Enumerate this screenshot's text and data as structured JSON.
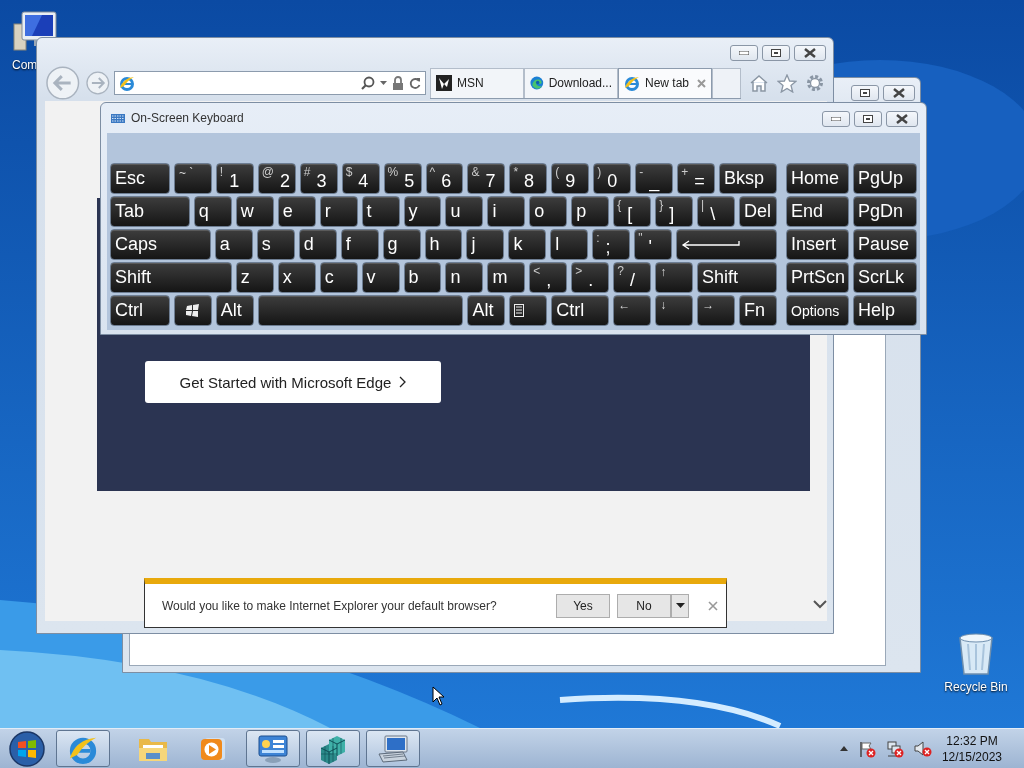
{
  "desktop_icons": [
    {
      "kind": "computer",
      "label": "Com"
    },
    {
      "kind": "recycle-bin",
      "label": "Recycle Bin"
    }
  ],
  "browser": {
    "tabs": [
      {
        "kind": "msn",
        "title": "MSN",
        "selected": false
      },
      {
        "kind": "edge",
        "title": "Download...",
        "selected": false
      },
      {
        "kind": "ie",
        "title": "New tab",
        "selected": true
      }
    ],
    "page": {
      "button": "Get Started with Microsoft Edge"
    },
    "notification": {
      "text": "Would you like to make Internet Explorer your default browser?",
      "buttons": [
        "Yes",
        "No"
      ]
    }
  },
  "keyboard": {
    "title": "On-Screen Keyboard",
    "rows": [
      {
        "keys": [
          {
            "kind": "text",
            "label": "Esc"
          },
          {
            "kind": "small",
            "label": "~ `"
          },
          {
            "kind": "dual",
            "shift": "!",
            "label": "1"
          },
          {
            "kind": "dual",
            "shift": "@",
            "label": "2"
          },
          {
            "kind": "dual",
            "shift": "#",
            "label": "3"
          },
          {
            "kind": "dual",
            "shift": "$",
            "label": "4"
          },
          {
            "kind": "dual",
            "shift": "%",
            "label": "5"
          },
          {
            "kind": "dual",
            "shift": "^",
            "label": "6"
          },
          {
            "kind": "dual",
            "shift": "&",
            "label": "7"
          },
          {
            "kind": "dual",
            "shift": "*",
            "label": "8"
          },
          {
            "kind": "dual",
            "shift": "(",
            "label": "9"
          },
          {
            "kind": "dual",
            "shift": ")",
            "label": "0"
          },
          {
            "kind": "dual",
            "shift": "-",
            "label": "_"
          },
          {
            "kind": "dual",
            "shift": "+",
            "label": "="
          },
          {
            "kind": "text",
            "label": "Bksp"
          }
        ],
        "side": [
          {
            "kind": "text",
            "label": "Home"
          },
          {
            "kind": "text",
            "label": "PgUp"
          }
        ]
      },
      {
        "keys": [
          {
            "kind": "text",
            "label": "Tab"
          },
          {
            "kind": "text",
            "label": "q"
          },
          {
            "kind": "text",
            "label": "w"
          },
          {
            "kind": "text",
            "label": "e"
          },
          {
            "kind": "text",
            "label": "r"
          },
          {
            "kind": "text",
            "label": "t"
          },
          {
            "kind": "text",
            "label": "y"
          },
          {
            "kind": "text",
            "label": "u"
          },
          {
            "kind": "text",
            "label": "i"
          },
          {
            "kind": "text",
            "label": "o"
          },
          {
            "kind": "text",
            "label": "p"
          },
          {
            "kind": "dual",
            "shift": "{",
            "label": "["
          },
          {
            "kind": "dual",
            "shift": "}",
            "label": "]"
          },
          {
            "kind": "dual",
            "shift": "|",
            "label": "\\"
          },
          {
            "kind": "text",
            "label": "Del"
          }
        ],
        "side": [
          {
            "kind": "text",
            "label": "End"
          },
          {
            "kind": "text",
            "label": "PgDn"
          }
        ]
      },
      {
        "keys": [
          {
            "kind": "text",
            "label": "Caps"
          },
          {
            "kind": "text",
            "label": "a"
          },
          {
            "kind": "text",
            "label": "s"
          },
          {
            "kind": "text",
            "label": "d"
          },
          {
            "kind": "text",
            "label": "f"
          },
          {
            "kind": "text",
            "label": "g"
          },
          {
            "kind": "text",
            "label": "h"
          },
          {
            "kind": "text",
            "label": "j"
          },
          {
            "kind": "text",
            "label": "k"
          },
          {
            "kind": "text",
            "label": "l"
          },
          {
            "kind": "dual",
            "shift": ":",
            "label": ";"
          },
          {
            "kind": "dual",
            "shift": "\"",
            "label": "'"
          },
          {
            "kind": "enter"
          }
        ],
        "side": [
          {
            "kind": "text",
            "label": "Insert"
          },
          {
            "kind": "text",
            "label": "Pause"
          }
        ]
      },
      {
        "keys": [
          {
            "kind": "text",
            "label": "Shift"
          },
          {
            "kind": "text",
            "label": "z"
          },
          {
            "kind": "text",
            "label": "x"
          },
          {
            "kind": "text",
            "label": "c"
          },
          {
            "kind": "text",
            "label": "v"
          },
          {
            "kind": "text",
            "label": "b"
          },
          {
            "kind": "text",
            "label": "n"
          },
          {
            "kind": "text",
            "label": "m"
          },
          {
            "kind": "dual",
            "shift": "<",
            "label": ","
          },
          {
            "kind": "dual",
            "shift": ">",
            "label": "."
          },
          {
            "kind": "dual",
            "shift": "?",
            "label": "/"
          },
          {
            "kind": "small",
            "label": "↑"
          },
          {
            "kind": "text",
            "label": "Shift"
          }
        ],
        "side": [
          {
            "kind": "text",
            "label": "PrtScn"
          },
          {
            "kind": "text",
            "label": "ScrLk"
          }
        ]
      },
      {
        "keys": [
          {
            "kind": "text",
            "label": "Ctrl"
          },
          {
            "kind": "windows"
          },
          {
            "kind": "text",
            "label": "Alt"
          },
          {
            "kind": "space"
          },
          {
            "kind": "text",
            "label": "Alt"
          },
          {
            "kind": "menu"
          },
          {
            "kind": "text",
            "label": "Ctrl"
          },
          {
            "kind": "small",
            "label": "←"
          },
          {
            "kind": "small",
            "label": "↓"
          },
          {
            "kind": "small",
            "label": "→"
          },
          {
            "kind": "text",
            "label": "Fn"
          }
        ],
        "side": [
          {
            "kind": "compact",
            "label": "Options"
          },
          {
            "kind": "text",
            "label": "Help"
          }
        ]
      }
    ]
  },
  "taskbar": {
    "items": [
      {
        "kind": "ie",
        "running": true
      },
      {
        "kind": "explorer",
        "running": false
      },
      {
        "kind": "media",
        "running": false
      },
      {
        "kind": "control-panel",
        "running": true
      },
      {
        "kind": "cubes",
        "running": true
      },
      {
        "kind": "keyboard-pc",
        "running": true
      }
    ],
    "time": "12:32 PM",
    "date": "12/15/2023"
  }
}
